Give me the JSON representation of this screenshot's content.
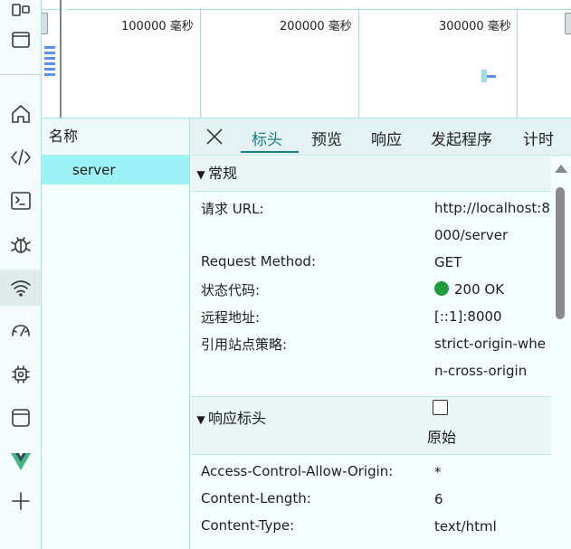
{
  "timeline": {
    "ticks": [
      "100000 毫秒",
      "200000 毫秒",
      "300000 毫秒"
    ]
  },
  "network": {
    "name_header": "名称",
    "requests": [
      "server"
    ]
  },
  "tabs": [
    "标头",
    "预览",
    "响应",
    "发起程序",
    "计时"
  ],
  "general": {
    "title": "常规",
    "rows": [
      {
        "key": "请求 URL:",
        "value": "http://localhost:8000/server"
      },
      {
        "key": "Request Method:",
        "value": "GET"
      },
      {
        "key": "状态代码:",
        "value": "200 OK"
      },
      {
        "key": "远程地址:",
        "value": "[::1]:8000"
      },
      {
        "key": "引用站点策略:",
        "value": "strict-origin-when-cross-origin"
      }
    ]
  },
  "response_headers": {
    "title": "响应标头",
    "raw_label": "原始",
    "rows": [
      {
        "key": "Access-Control-Allow-Origin:",
        "value": "*"
      },
      {
        "key": "Content-Length:",
        "value": "6"
      },
      {
        "key": "Content-Type:",
        "value": "text/html"
      }
    ]
  },
  "colors": {
    "accent": "#1a7f86",
    "selected_row": "#9cf2f6",
    "status_ok": "#1e9e3a"
  }
}
